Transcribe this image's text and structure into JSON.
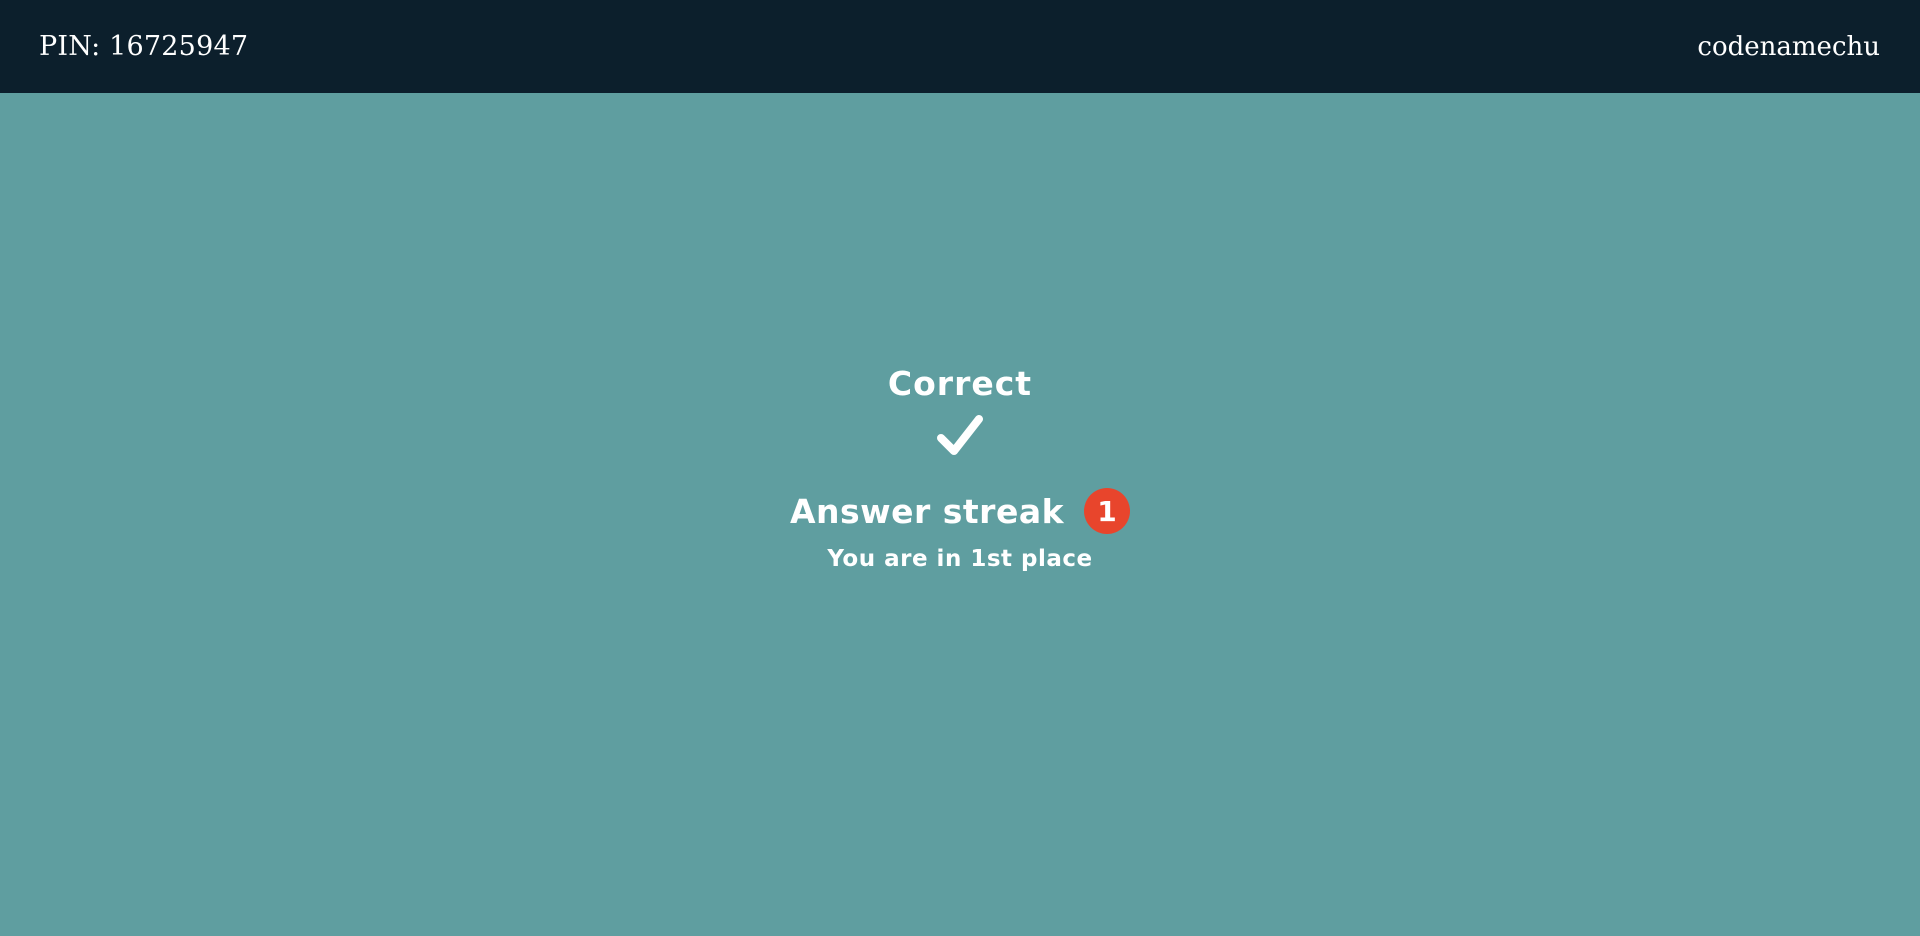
{
  "header": {
    "pin": "PIN: 16725947",
    "username": "codenamechu"
  },
  "result": {
    "title": "Correct",
    "icon": "checkmark-icon",
    "streak_label": "Answer streak",
    "streak_count": "1",
    "place_text": "You are in 1st place"
  },
  "colors": {
    "background": "#5f9ea0",
    "topbar": "#0c1f2c",
    "badge": "#e8452c",
    "text": "#ffffff"
  }
}
